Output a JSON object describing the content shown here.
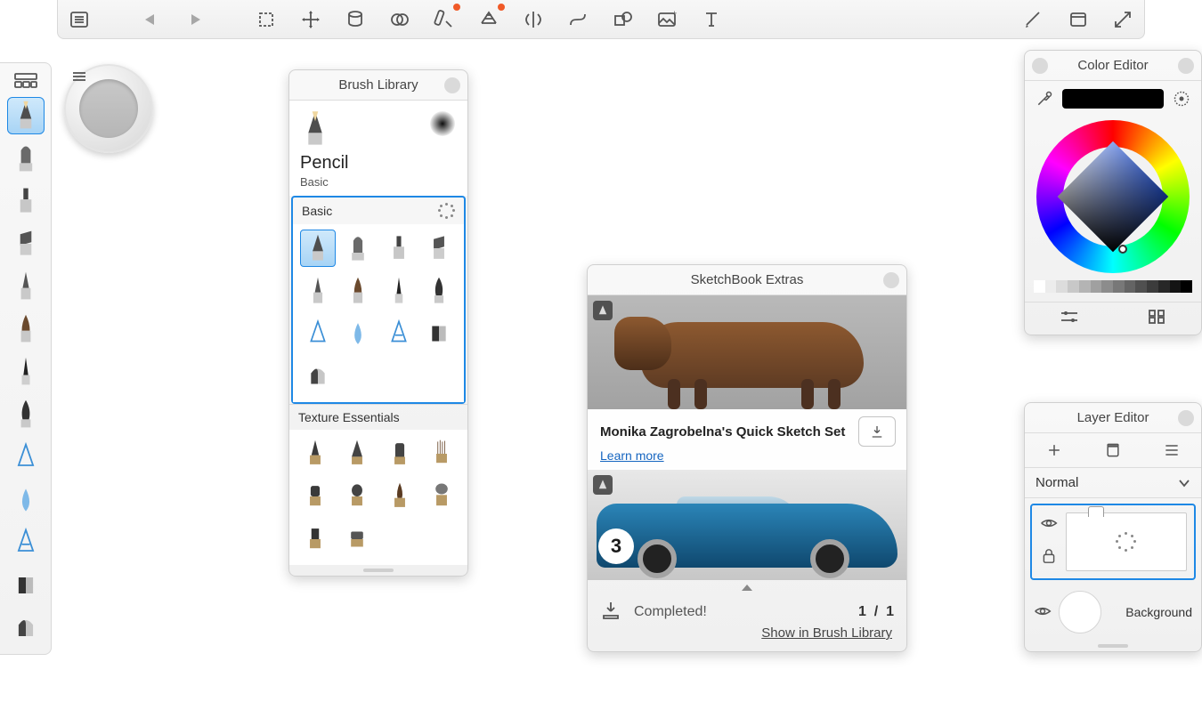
{
  "toolbar": {
    "items": [
      {
        "name": "menu-list-icon"
      },
      {
        "name": "undo-icon"
      },
      {
        "name": "redo-icon"
      },
      {
        "name": "selection-icon"
      },
      {
        "name": "transform-icon"
      },
      {
        "name": "fill-icon"
      },
      {
        "name": "color-mix-icon"
      },
      {
        "name": "ruler-icon",
        "badge": true
      },
      {
        "name": "perspective-icon",
        "badge": true
      },
      {
        "name": "symmetry-icon"
      },
      {
        "name": "curve-icon"
      },
      {
        "name": "shape-icon"
      },
      {
        "name": "import-image-icon"
      },
      {
        "name": "text-icon"
      }
    ],
    "right": [
      {
        "name": "brush-puck-toggle-icon"
      },
      {
        "name": "panels-icon"
      },
      {
        "name": "fullscreen-icon"
      }
    ]
  },
  "brushSidebar": {
    "tops": "palette-grid-icon",
    "selectedIndex": 0,
    "brushes": [
      "pencil",
      "pencil-blunt",
      "marker",
      "chisel",
      "pen",
      "brush-wide",
      "ink",
      "nib",
      "hard-round",
      "soft-round",
      "erase-hard",
      "half-fill",
      "half-fill-2"
    ]
  },
  "brushLibrary": {
    "title": "Brush Library",
    "currentBrush": {
      "name": "Pencil",
      "category": "Basic"
    },
    "sets": [
      {
        "name": "Basic",
        "selected": true,
        "brushes": [
          "pencil",
          "pencil-2",
          "marker",
          "chisel",
          "pen",
          "flat",
          "ink",
          "nib",
          "hard",
          "soft",
          "erase",
          "half",
          "half-2"
        ]
      },
      {
        "name": "Texture Essentials",
        "brushes": [
          "tex1",
          "tex2",
          "tex3",
          "tex4",
          "tex5",
          "tex6",
          "tex7",
          "tex8",
          "tex9",
          "tex10"
        ]
      }
    ]
  },
  "sketchbookExtras": {
    "title": "SketchBook Extras",
    "item": {
      "title": "Monika Zagrobelna's Quick Sketch Set",
      "learnMore": "Learn more"
    },
    "completed": "Completed!",
    "count": "1",
    "total": "1",
    "showLink": "Show in Brush Library"
  },
  "colorEditor": {
    "title": "Color Editor",
    "currentColor": "#000000",
    "grays": [
      "#ffffff",
      "#ececec",
      "#dcdcdc",
      "#c8c8c8",
      "#b4b4b4",
      "#a0a0a0",
      "#8c8c8c",
      "#787878",
      "#646464",
      "#505050",
      "#3c3c3c",
      "#282828",
      "#141414",
      "#000000"
    ]
  },
  "layerEditor": {
    "title": "Layer Editor",
    "blendMode": "Normal",
    "backgroundLabel": "Background"
  }
}
